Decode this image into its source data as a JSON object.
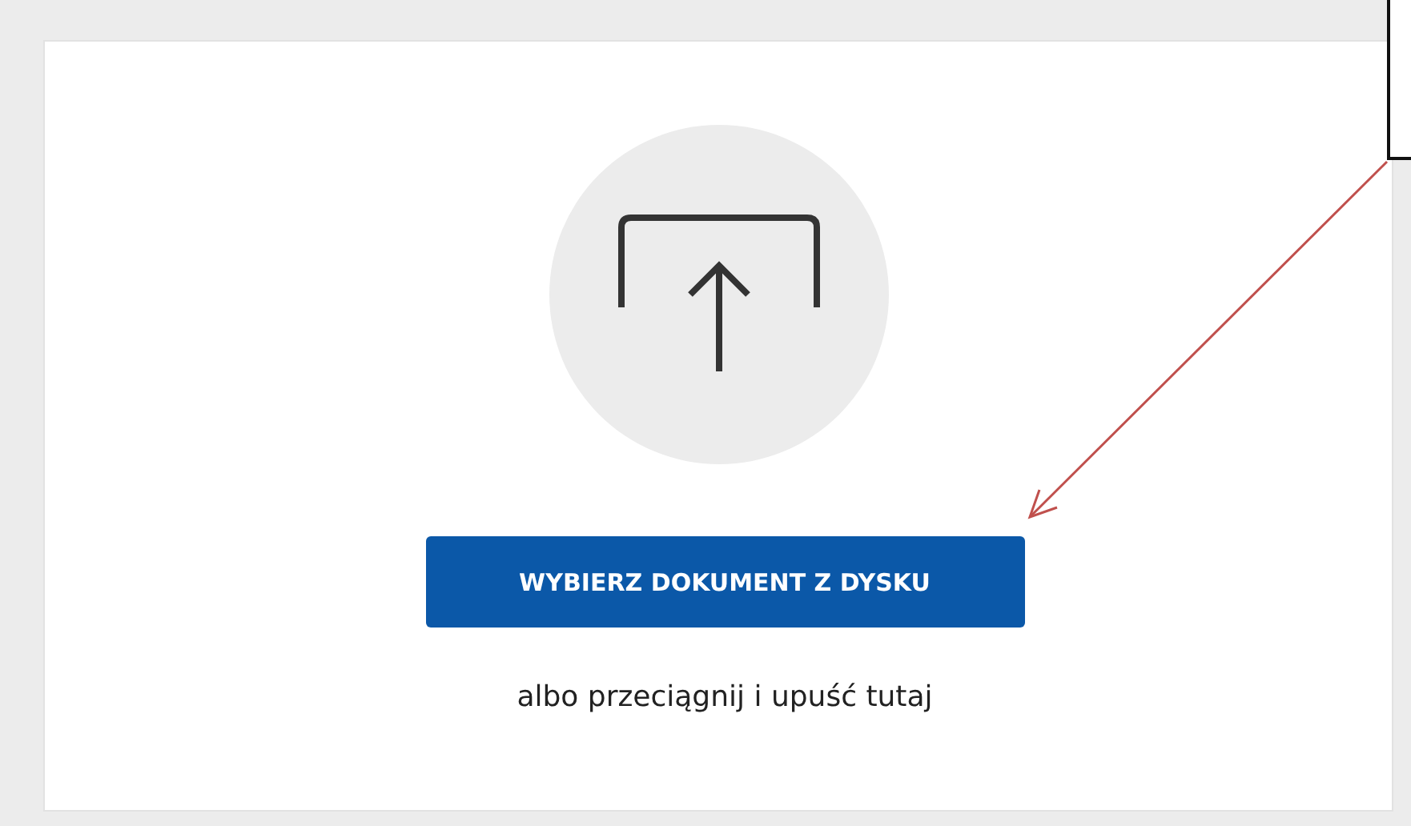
{
  "upload": {
    "button": "WYBIERZ DOKUMENT Z DYSKU",
    "hint": "albo przeciągnij i upuść tutaj"
  }
}
